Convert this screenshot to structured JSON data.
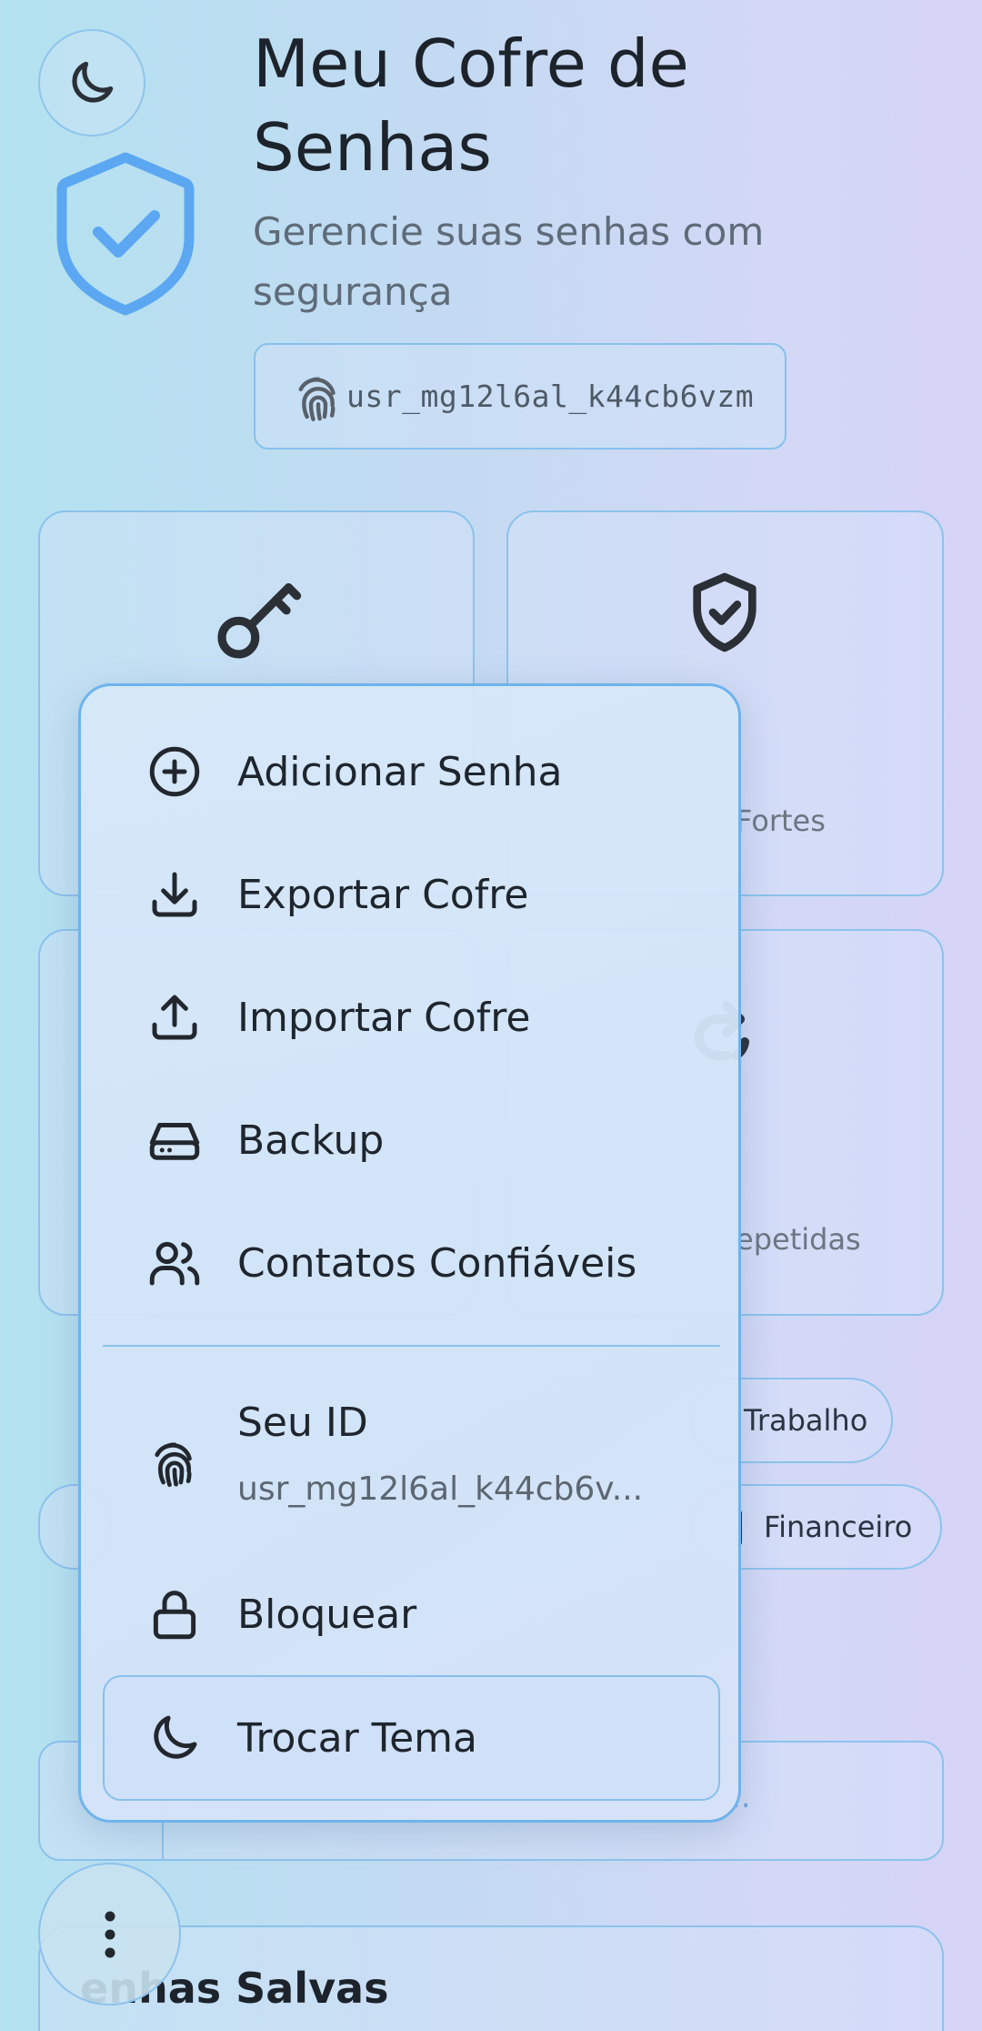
{
  "header": {
    "title": "Meu Cofre de Senhas",
    "subtitle": "Gerencie suas senhas com segurança",
    "user_id": "usr_mg12l6al_k44cb6vzm"
  },
  "stats": {
    "card2_label_partial": "Fortes",
    "card4_label_partial": "epetidas"
  },
  "categories": {
    "chip_trabalho": "Trabalho",
    "chip_financeiro": "Financeiro"
  },
  "search": {
    "placeholder_partial": ".."
  },
  "list": {
    "title_partial": "enhas Salvas"
  },
  "menu": {
    "items": [
      {
        "label": "Adicionar Senha",
        "icon": "plus-circle-icon"
      },
      {
        "label": "Exportar Cofre",
        "icon": "download-icon"
      },
      {
        "label": "Importar Cofre",
        "icon": "upload-icon"
      },
      {
        "label": "Backup",
        "icon": "hard-drive-icon"
      },
      {
        "label": "Contatos Confiáveis",
        "icon": "users-icon"
      }
    ],
    "id_label": "Seu ID",
    "id_value": "usr_mg12l6al_k44cb6v...",
    "lock_label": "Bloquear",
    "theme_label": "Trocar Tema"
  },
  "colors": {
    "accent": "#5aa6f0",
    "border": "#8cc2ec"
  }
}
